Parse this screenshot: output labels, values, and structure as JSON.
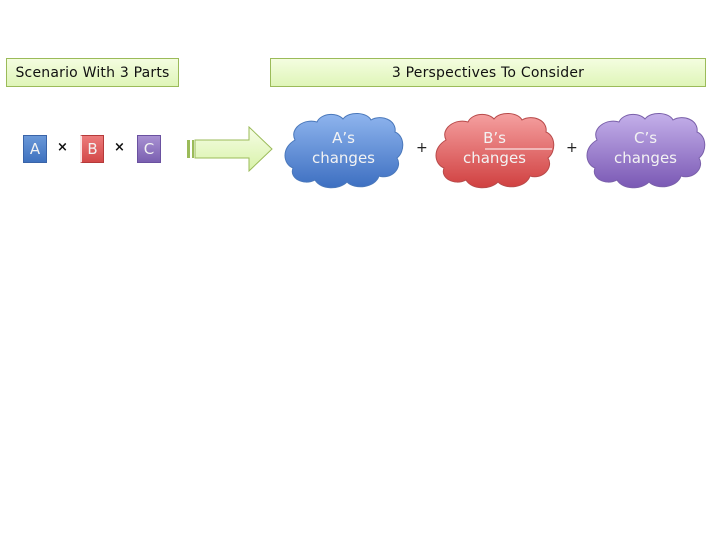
{
  "headers": {
    "scenario": "Scenario With 3 Parts",
    "perspectives": "3 Perspectives To Consider"
  },
  "parts": [
    {
      "label": "A",
      "color": "#4f81bd"
    },
    {
      "label": "B",
      "color": "#c0504d"
    },
    {
      "label": "C",
      "color": "#8064a2"
    }
  ],
  "operators": {
    "times": "×",
    "plus": "+"
  },
  "clouds": [
    {
      "line1": "A’s",
      "line2": "changes",
      "color": "#4f81bd"
    },
    {
      "line1": "B’s",
      "line2": "changes",
      "color": "#c0504d"
    },
    {
      "line1": "C’s",
      "line2": "changes",
      "color": "#8064a2"
    }
  ],
  "accent_green": "#9bbb59"
}
